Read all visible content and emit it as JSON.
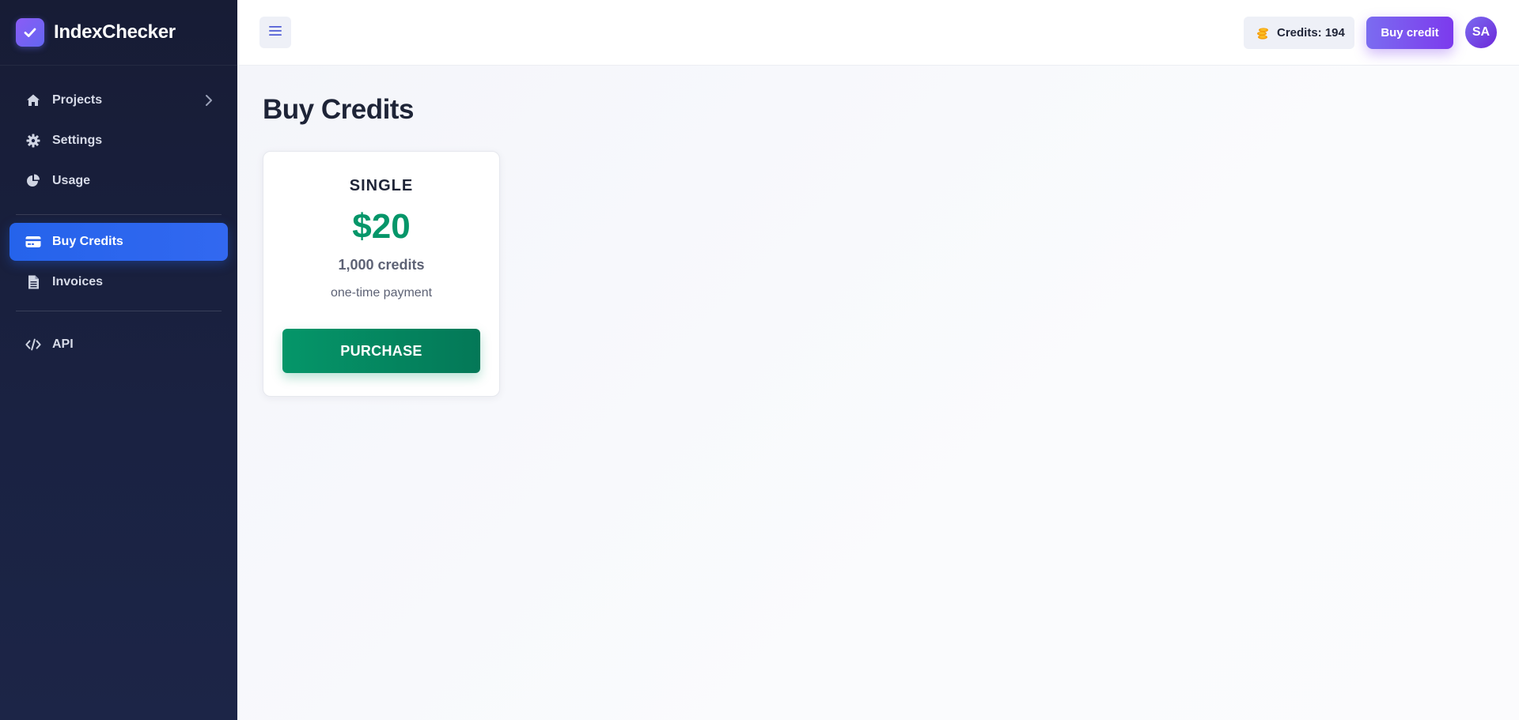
{
  "app": {
    "name": "IndexChecker"
  },
  "sidebar": {
    "items": [
      {
        "label": "Projects",
        "icon": "home-icon"
      },
      {
        "label": "Settings",
        "icon": "gear-icon"
      },
      {
        "label": "Usage",
        "icon": "pie-chart-icon"
      },
      {
        "label": "Buy Credits",
        "icon": "credit-card-icon",
        "active": true
      },
      {
        "label": "Invoices",
        "icon": "invoice-icon"
      },
      {
        "label": "API",
        "icon": "code-icon"
      }
    ]
  },
  "header": {
    "credits_label": "Credits: 194",
    "buy_button_label": "Buy credit",
    "avatar_initials": "SA"
  },
  "main": {
    "title": "Buy Credits",
    "plan": {
      "name": "SINGLE",
      "price": "$20",
      "credits": "1,000 credits",
      "note": "one-time payment",
      "button_label": "PURCHASE"
    }
  },
  "colors": {
    "accent": "#2563eb",
    "brand": "#7c3aed",
    "price": "#059669",
    "sidebar": "#1a2242"
  }
}
